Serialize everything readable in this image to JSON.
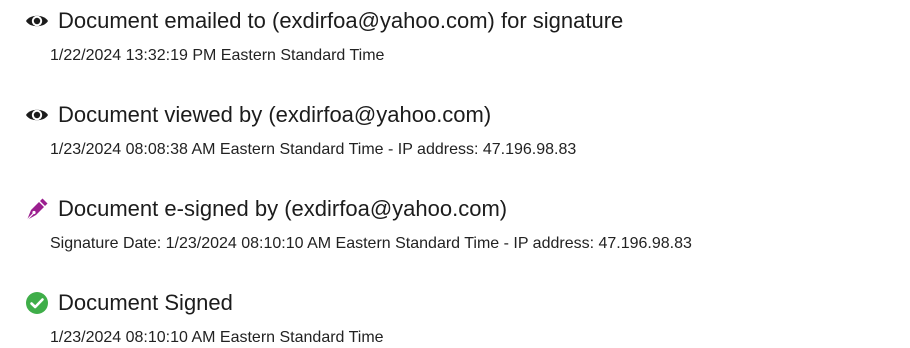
{
  "events": [
    {
      "icon": "eye-icon",
      "title": "Document emailed to (exdirfoa@yahoo.com) for signature",
      "detail": "1/22/2024 13:32:19 PM Eastern Standard Time"
    },
    {
      "icon": "eye-icon",
      "title": "Document viewed by (exdirfoa@yahoo.com)",
      "detail": "1/23/2024 08:08:38 AM Eastern Standard Time - IP address: 47.196.98.83"
    },
    {
      "icon": "pen-icon",
      "title": "Document e-signed by (exdirfoa@yahoo.com)",
      "detail": "Signature Date: 1/23/2024 08:10:10 AM Eastern Standard Time - IP address: 47.196.98.83"
    },
    {
      "icon": "check-circle-icon",
      "title": "Document Signed",
      "detail": "1/23/2024 08:10:10 AM Eastern Standard Time"
    }
  ],
  "colors": {
    "eye": "#1c1c1c",
    "pen": "#9b1f8f",
    "check": "#3fae49"
  }
}
